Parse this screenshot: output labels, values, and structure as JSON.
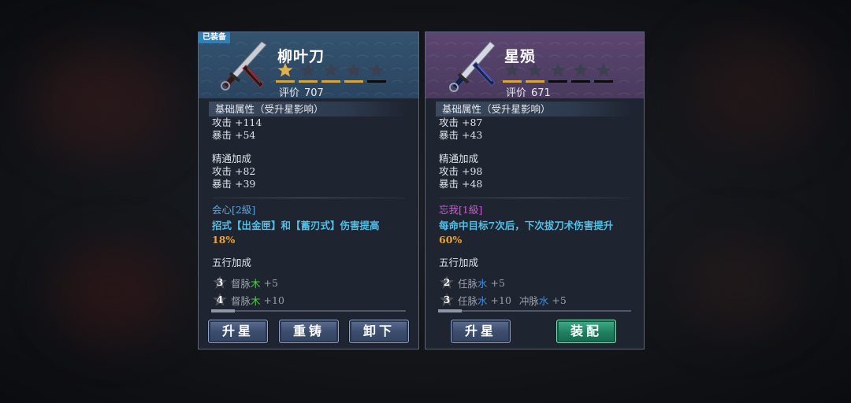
{
  "colors": {
    "left_header": "#2b4560",
    "right_header": "#4a3a5e",
    "star_on": "#d9a43a",
    "skill_desc": "#4fc0ea",
    "highlight": "#e6a23a",
    "wood": "#4ccd45",
    "water": "#3d8fe6",
    "equip_button": "#1f7f5f"
  },
  "left_card": {
    "equipped_tag": "已装备",
    "name": "柳叶刀",
    "stars_filled": 1,
    "stars_total": 5,
    "rating_label": "评价",
    "rating_value": "707",
    "base_title": "基础属性（受升星影响）",
    "base_stats": [
      "攻击 +114",
      "暴击 +54"
    ],
    "mastery_title": "精通加成",
    "mastery_stats": [
      "攻击 +82",
      "暴击 +39"
    ],
    "skill_name": "会心[2級]",
    "skill_desc": "招式【出金匣】和【蓄刃式】伤害提高",
    "skill_pct": "18%",
    "element_title": "五行加成",
    "elements": [
      {
        "count": "3",
        "prefix": "督脉",
        "element": "木",
        "bonus": "+5"
      },
      {
        "count": "4",
        "prefix": "督脉",
        "element": "木",
        "bonus": "+10"
      }
    ],
    "buttons": [
      "升星",
      "重铸",
      "卸下"
    ]
  },
  "right_card": {
    "name": "星殒",
    "stars_filled": 2,
    "stars_total": 5,
    "rating_label": "评价",
    "rating_value": "671",
    "base_title": "基础属性（受升星影响）",
    "base_stats": [
      "攻击 +87",
      "暴击 +43"
    ],
    "mastery_title": "精通加成",
    "mastery_stats": [
      "攻击 +98",
      "暴击 +48"
    ],
    "skill_name": "忘我[1級]",
    "skill_desc": "每命中目标7次后，下次拔刀术伤害提升",
    "skill_pct": "60%",
    "element_title": "五行加成",
    "elements": [
      {
        "count": "2",
        "prefix": "任脉",
        "element": "水",
        "bonus": "+5"
      },
      {
        "count": "3",
        "prefix": "任脉",
        "element": "水",
        "bonus": "+10",
        "extra_prefix": "冲脉",
        "extra_element": "水",
        "extra_bonus": "+5"
      }
    ],
    "buttons": [
      "升星",
      "装配"
    ]
  }
}
